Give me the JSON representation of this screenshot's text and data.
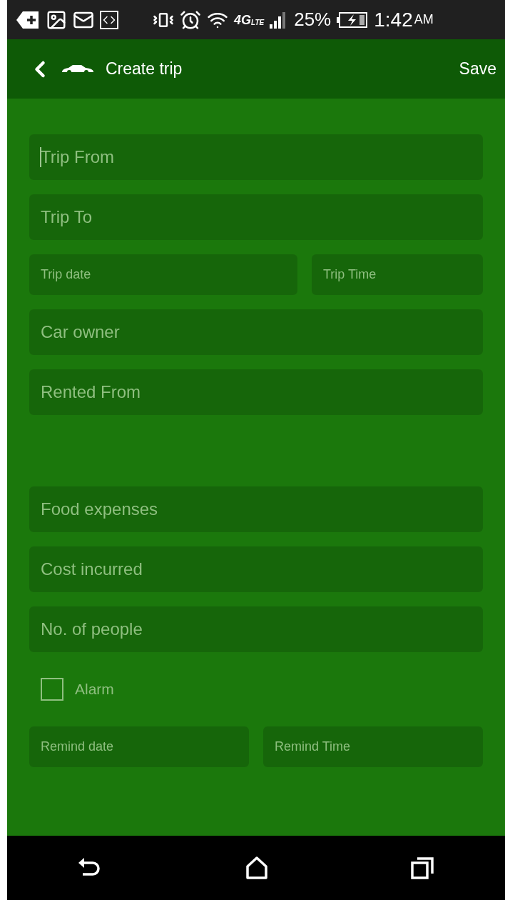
{
  "status_bar": {
    "battery": "25%",
    "time": "1:42",
    "am_pm": "AM",
    "network": "4G",
    "network_sub": "LTE"
  },
  "header": {
    "title": "Create trip",
    "action": "Save"
  },
  "form_top": [
    {
      "kind": "full",
      "fields": [
        {
          "placeholder": "Trip From",
          "focused": true
        }
      ]
    },
    {
      "kind": "full",
      "fields": [
        {
          "placeholder": "Trip To",
          "focused": false
        }
      ]
    },
    {
      "kind": "date-time",
      "fields": [
        {
          "placeholder": "Trip date",
          "focused": false
        },
        {
          "placeholder": "Trip Time",
          "focused": false
        }
      ]
    },
    {
      "kind": "full",
      "fields": [
        {
          "placeholder": "Car owner",
          "focused": false
        }
      ]
    },
    {
      "kind": "full",
      "fields": [
        {
          "placeholder": "Rented From",
          "focused": false
        }
      ]
    }
  ],
  "form_bottom": [
    {
      "kind": "full",
      "fields": [
        {
          "placeholder": "Food expenses",
          "focused": false
        }
      ]
    },
    {
      "kind": "full",
      "fields": [
        {
          "placeholder": "Cost incurred",
          "focused": false
        }
      ]
    },
    {
      "kind": "full",
      "fields": [
        {
          "placeholder": "No. of people",
          "focused": false
        }
      ]
    }
  ],
  "alarm": {
    "label": "Alarm",
    "checked": false
  },
  "reminder": {
    "kind": "reminder",
    "fields": [
      {
        "placeholder": "Remind date",
        "focused": false
      },
      {
        "placeholder": "Remind Time",
        "focused": false
      }
    ]
  }
}
